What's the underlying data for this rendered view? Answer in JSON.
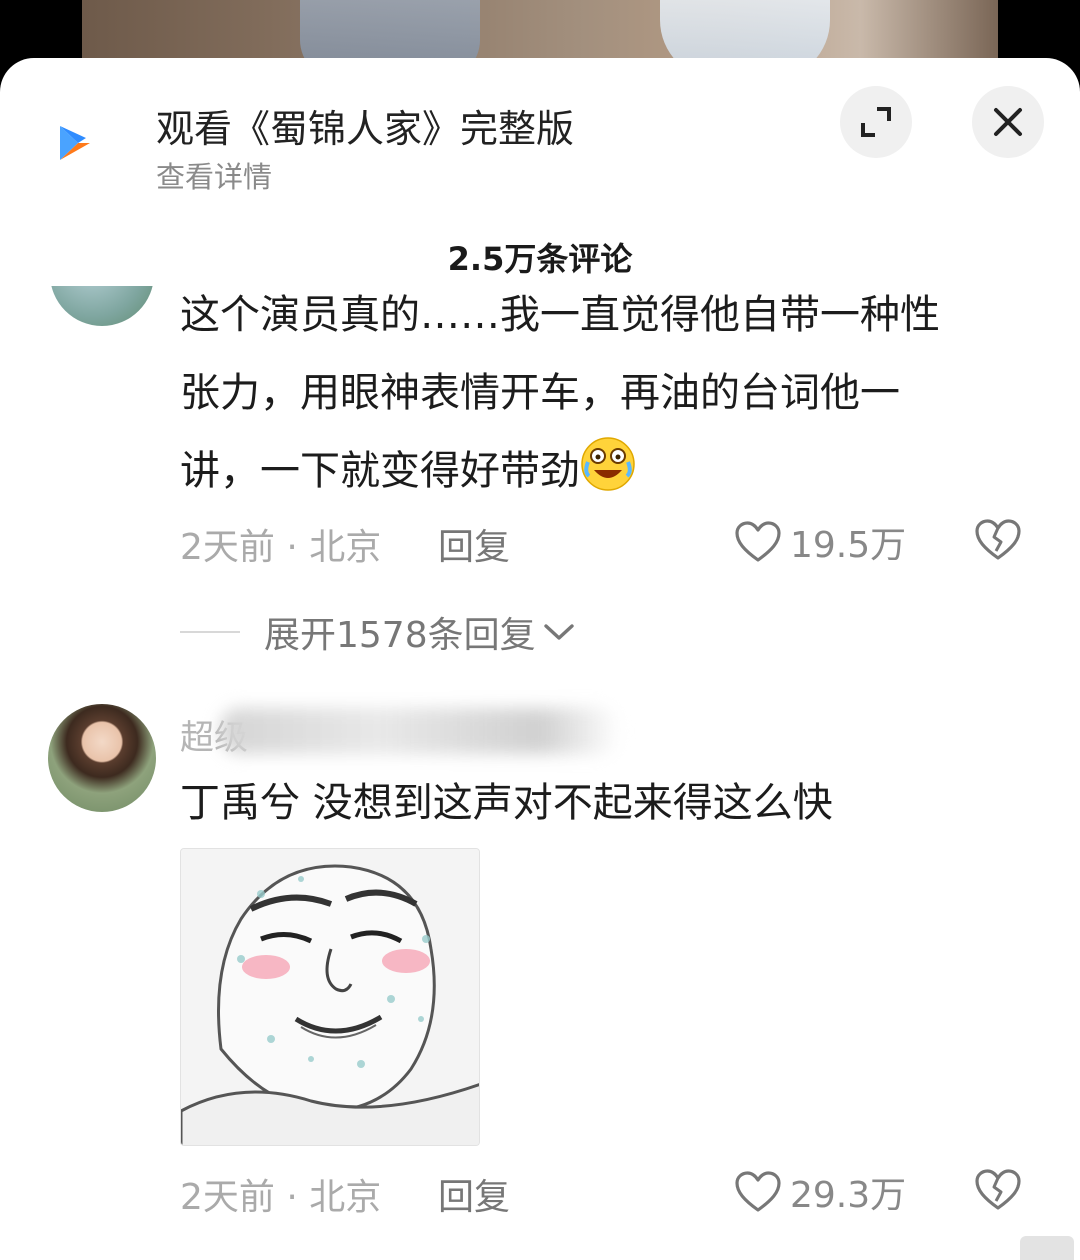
{
  "ad": {
    "title": "观看《蜀锦人家》完整版",
    "subtitle": "查看详情",
    "expand_icon": "expand-icon",
    "close_icon": "close-icon"
  },
  "comments_header": "2.5万条评论",
  "comments": [
    {
      "text_lines": [
        "这个演员真的……我一直觉得他自带一种性",
        "张力，用眼神表情开车，再油的台词他一",
        "讲，一下就变得好带劲"
      ],
      "emoji": "laughing-crying-emoji",
      "time_location": "2天前 · 北京",
      "reply_label": "回复",
      "likes": "19.5万",
      "expand_replies": "展开1578条回复"
    },
    {
      "username": "超级",
      "text": "丁禹兮  没想到这声对不起来得这么快",
      "has_image": true,
      "time_location": "2天前 · 北京",
      "reply_label": "回复",
      "likes": "29.3万"
    }
  ],
  "colors": {
    "accent_blue": "#2f8cff",
    "accent_orange": "#ff7a1a"
  }
}
